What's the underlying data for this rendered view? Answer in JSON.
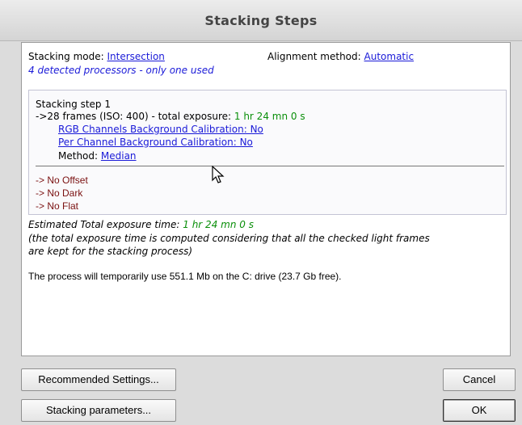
{
  "window": {
    "title": "Stacking Steps"
  },
  "header": {
    "stacking_mode_label": "Stacking mode:",
    "stacking_mode_value": "Intersection",
    "alignment_label": "Alignment method:",
    "alignment_value": "Automatic",
    "processors_note": "4 detected processors - only one used"
  },
  "step": {
    "title": "Stacking step 1",
    "frames_text": "->28 frames (ISO: 400) - total exposure:",
    "frames_exposure": "1 hr 24 mn 0 s",
    "rgb_calibration": "RGB Channels Background Calibration: No",
    "per_channel_calibration": "Per Channel Background Calibration: No",
    "method_label": "Method:",
    "method_value": "Median",
    "offset": "-> No Offset",
    "dark": "-> No Dark",
    "flat": "-> No Flat"
  },
  "summary": {
    "estimated_label": "Estimated Total exposure time:",
    "estimated_value": "1 hr 24 mn 0 s",
    "note_line1": "(the total exposure time is computed considering that all the checked light frames",
    "note_line2": "are kept for the stacking process)",
    "disk_usage": "The process will temporarily use 551.1 Mb on the C: drive (23.7 Gb free)."
  },
  "buttons": {
    "recommended": "Recommended Settings...",
    "stacking_params": "Stacking parameters...",
    "cancel": "Cancel",
    "ok": "OK"
  },
  "colors": {
    "link": "#1a1ad8",
    "exposure": "#0a8f0a",
    "warning": "#7a1010"
  }
}
